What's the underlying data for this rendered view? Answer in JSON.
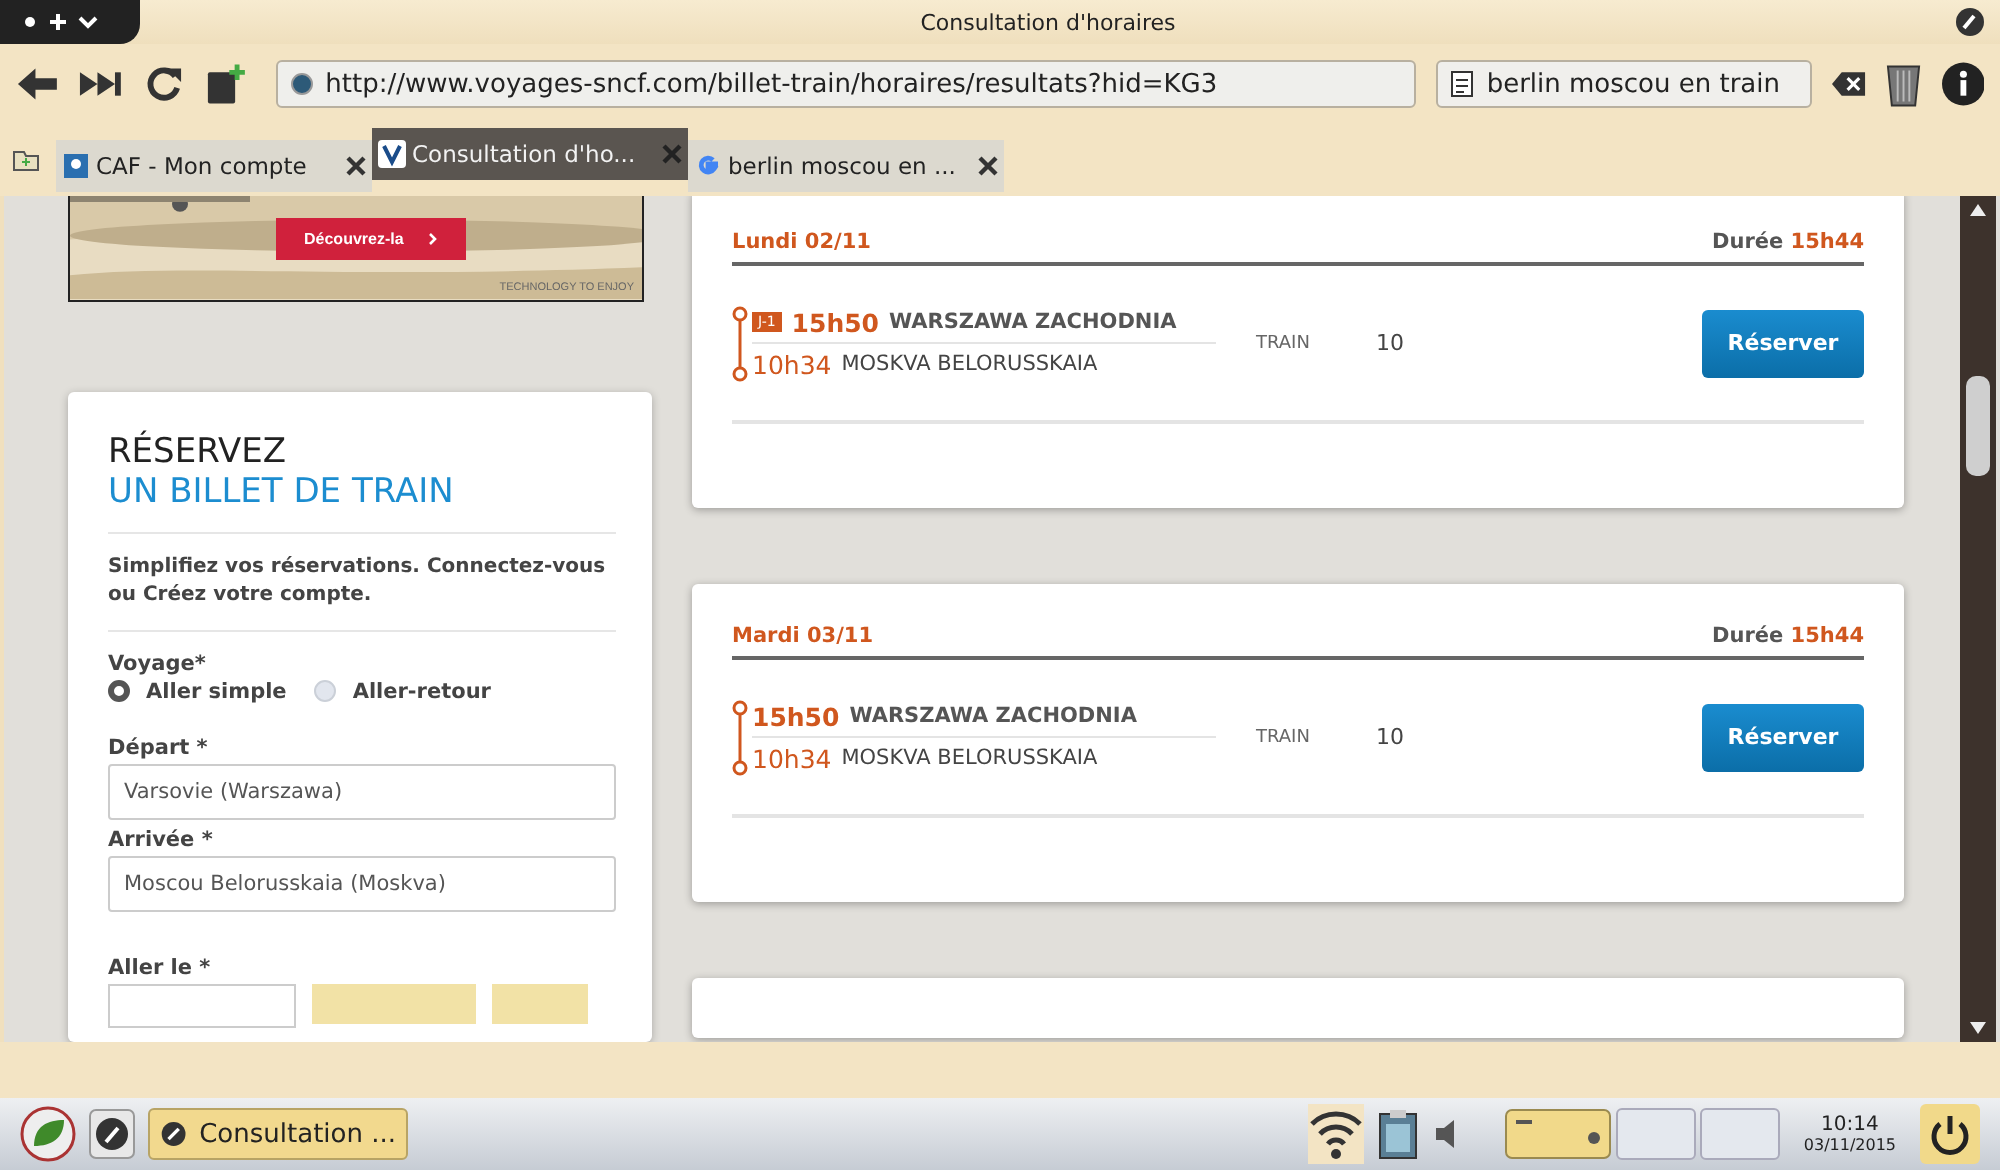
{
  "window": {
    "title": "Consultation d'horaires"
  },
  "toolbar": {
    "url": "http://www.voyages-sncf.com/billet-train/horaires/resultats?hid=KG3",
    "search": "berlin moscou en train"
  },
  "tabs": [
    {
      "label": "CAF - Mon compte",
      "selected": false
    },
    {
      "label": "Consultation d'ho...",
      "selected": true
    },
    {
      "label": "berlin moscou en ...",
      "selected": false
    }
  ],
  "ad": {
    "button": "Découvrez-la",
    "tagline": "TECHNOLOGY TO ENJOY"
  },
  "booking_form": {
    "title_line1": "RÉSERVEZ",
    "title_line2": "UN BILLET DE TRAIN",
    "intro": "Simplifiez vos réservations. Connectez-vous ou Créez votre compte.",
    "voyage_label": "Voyage*",
    "trip_types": [
      {
        "label": "Aller simple",
        "selected": true
      },
      {
        "label": "Aller-retour",
        "selected": false
      }
    ],
    "departure_label": "Départ *",
    "departure_value": "Varsovie (Warszawa)",
    "arrival_label": "Arrivée *",
    "arrival_value": "Moscou Belorusskaia (Moskva)",
    "date_label": "Aller le *"
  },
  "results": [
    {
      "date": "Lundi 02/11",
      "duration_label": "Durée",
      "duration": "15h44",
      "badge": "J-1",
      "departure_time": "15h50",
      "departure_station": "WARSZAWA ZACHODNIA",
      "arrival_time": "10h34",
      "arrival_station": "MOSKVA BELORUSSKAIA",
      "mode": "TRAIN",
      "number": "10",
      "button": "Réserver"
    },
    {
      "date": "Mardi 03/11",
      "duration_label": "Durée",
      "duration": "15h44",
      "departure_time": "15h50",
      "departure_station": "WARSZAWA ZACHODNIA",
      "arrival_time": "10h34",
      "arrival_station": "MOSKVA BELORUSSKAIA",
      "mode": "TRAIN",
      "number": "10",
      "button": "Réserver"
    }
  ],
  "taskbar": {
    "task": "Consultation ...",
    "time": "10:14",
    "date": "03/11/2015"
  }
}
